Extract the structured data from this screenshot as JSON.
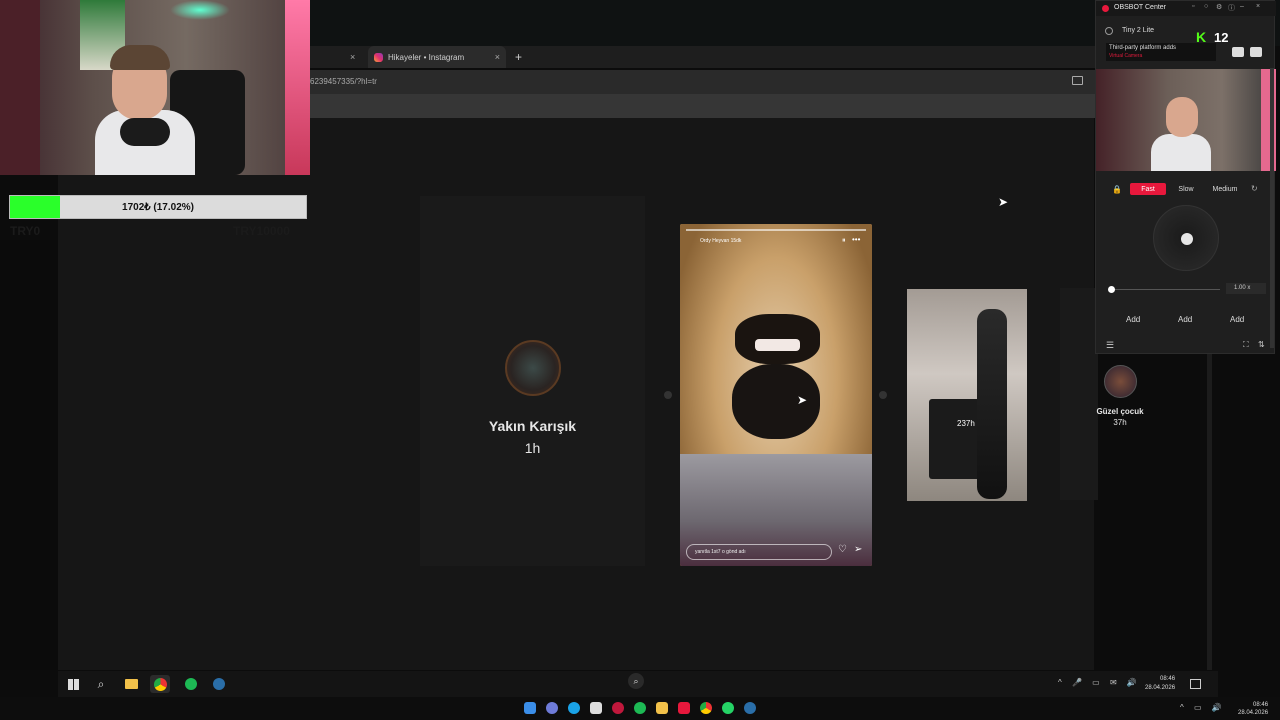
{
  "browser": {
    "tab_active_title": "Hikayeler • Instagram",
    "tab_close": "×",
    "prev_tab_close": "×",
    "new_tab": "+",
    "url": "6239457335/?hl=tr"
  },
  "overlay": {
    "donation_text": "1702₺ (17.02%)",
    "donation_progress": 0.1702,
    "goal_min": "TRY0",
    "goal_max": "TRY10000"
  },
  "stories": {
    "left": {
      "name": "Yakın Karışık",
      "time": "1h"
    },
    "main": {
      "user": "Ordy Heyvan 15dk",
      "pause": "⏸",
      "more": "•••",
      "reply_placeholder": "yanıtla 1st7 o gönd adı",
      "heart": "♡",
      "send": "➢"
    },
    "next": {
      "time": "237h"
    },
    "right": {
      "name": "Güzel çocuk",
      "time": "37h"
    }
  },
  "obsbot": {
    "title": "OBSBOT Center",
    "device": "Tiny 2 Lite",
    "toast_text": "Third-party platform adds",
    "toast_sub": "Virtual Camera",
    "kick_badge": "K",
    "kick_count": "12",
    "speed": {
      "fast": "Fast",
      "slow": "Slow",
      "medium": "Medium"
    },
    "zoom_value": "1.00 x",
    "zoom_level": 0.0,
    "add_labels": [
      "Add",
      "Add",
      "Add"
    ],
    "lock": "🔒",
    "reset": "↻",
    "menu": "☰",
    "fit": "⛶",
    "adjust": "⇅"
  },
  "taskbar": {
    "search": "⌕",
    "clock_time": "08:46",
    "clock_date": "28.04.2026",
    "tray_icons": "^ 🎤 ▭ ✉ 🔊",
    "outer_clock_time": "08:46",
    "outer_clock_date": "28.04.2026",
    "outer_tray": "^ ▭ 🔊"
  },
  "colors": {
    "accent": "#e8183c",
    "kick_green": "#53fc18",
    "donation_green": "#2aff2a"
  }
}
